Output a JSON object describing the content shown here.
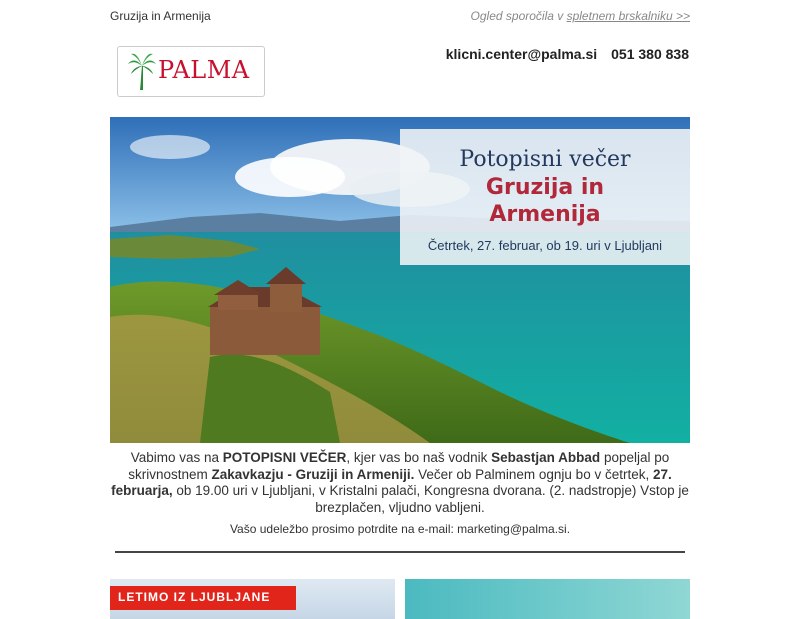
{
  "header": {
    "subject": "Gruzija in Armenija",
    "browser_prefix": "Ogled sporočila v ",
    "browser_link": "spletnem brskalniku >>"
  },
  "logo": {
    "brand": "PALMA"
  },
  "contact": {
    "email": "klicni.center@palma.si",
    "phone": "051 380 838"
  },
  "hero": {
    "line1": "Potopisni večer",
    "line2a": "Gruzija in",
    "line2b": "Armenija",
    "line3": "Četrtek, 27. februar, ob 19. uri v Ljubljani"
  },
  "intro": {
    "t1": "Vabimo vas na ",
    "b1": "POTOPISNI VEČER",
    "t2": ", kjer vas bo naš vodnik ",
    "b2": "Sebastjan Abbad",
    "t3": " popeljal po skrivnostnem ",
    "b3": "Zakavkazju - Gruziji in Armeniji.",
    "t4": "  Večer ob Palminem ognju bo v četrtek, ",
    "b4": "27. februarja,",
    "t5": " ob 19.00 uri v Ljubljani, v Kristalni palači, Kongresna dvorana. (2. nadstropje) Vstop je brezplačen, vljudno vabljeni."
  },
  "confirm": "Vašo udeležbo prosimo potrdite na e-mail: marketing@palma.si.",
  "cards": {
    "card1_tag": "LETIMO IZ LJUBLJANE"
  },
  "colors": {
    "brand_red": "#c8102e",
    "overlay_navy": "#23395d",
    "overlay_red": "#b0283a"
  }
}
